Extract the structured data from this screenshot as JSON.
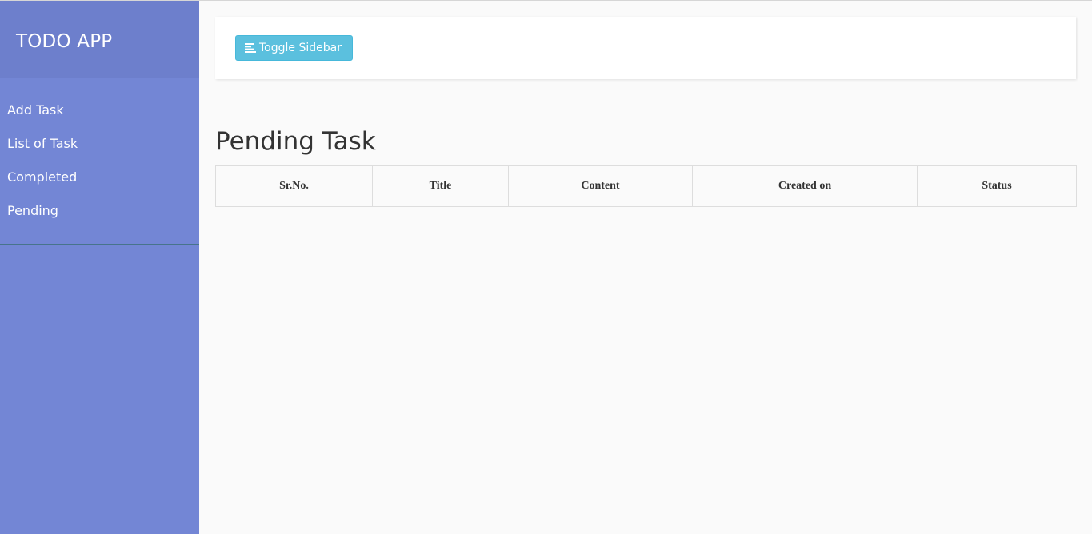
{
  "sidebar": {
    "brand": "TODO APP",
    "items": [
      {
        "label": "Add Task"
      },
      {
        "label": "List of Task"
      },
      {
        "label": "Completed"
      },
      {
        "label": "Pending"
      }
    ]
  },
  "topbar": {
    "toggle_label": "Toggle Sidebar",
    "toggle_icon": "align-left-icon"
  },
  "main": {
    "title": "Pending Task",
    "table": {
      "columns": [
        "Sr.No.",
        "Title",
        "Content",
        "Created on",
        "Status"
      ],
      "rows": []
    }
  },
  "colors": {
    "sidebar": "#7386d5",
    "sidebar_header": "#6d7fcc",
    "button": "#5bc0de"
  }
}
